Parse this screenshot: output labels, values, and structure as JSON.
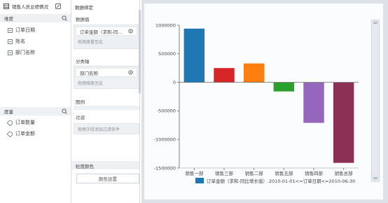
{
  "dataset": {
    "title": "销售人员业绩情况"
  },
  "dimensions": {
    "header": "维度",
    "items": [
      {
        "label": "订单日期"
      },
      {
        "label": "姓名"
      },
      {
        "label": "部门名称"
      }
    ]
  },
  "measures": {
    "header": "度量",
    "items": [
      {
        "label": "订单数量"
      },
      {
        "label": "订单金额"
      }
    ]
  },
  "binding": {
    "title": "数据绑定",
    "value_label": "数据值",
    "value_chip": "订单金额（求和-同...",
    "value_hint": "拖拽度量至此",
    "category_label": "分类轴",
    "category_chip": "部门名称",
    "category_hint": "拖拽维度至此",
    "legend_label": "图例",
    "filter_label": "过滤",
    "filter_hint": "拖拽字段添加过滤条件",
    "color_label": "粒度颜色",
    "color_button": "颜色设置"
  },
  "colors": {
    "accent": "#1f77b4"
  },
  "chart_data": {
    "type": "bar",
    "categories": [
      "销售一部",
      "销售三部",
      "销售二部",
      "销售五部",
      "销售四部",
      "销售总部"
    ],
    "values": [
      940000,
      250000,
      330000,
      -160000,
      -710000,
      -1410000
    ],
    "colors": [
      "#1f77b4",
      "#d62728",
      "#ff7f0e",
      "#2ca02c",
      "#9467bd",
      "#8c3156"
    ],
    "ylim": [
      -1500000,
      1000000
    ],
    "yticks": [
      "1000000",
      "500000",
      "0",
      "-500000",
      "-1000000",
      "-1500000"
    ],
    "legend": "订单金额（求和-同比增长值）.2010-01-01<=订单日期<=2010-06-30"
  }
}
